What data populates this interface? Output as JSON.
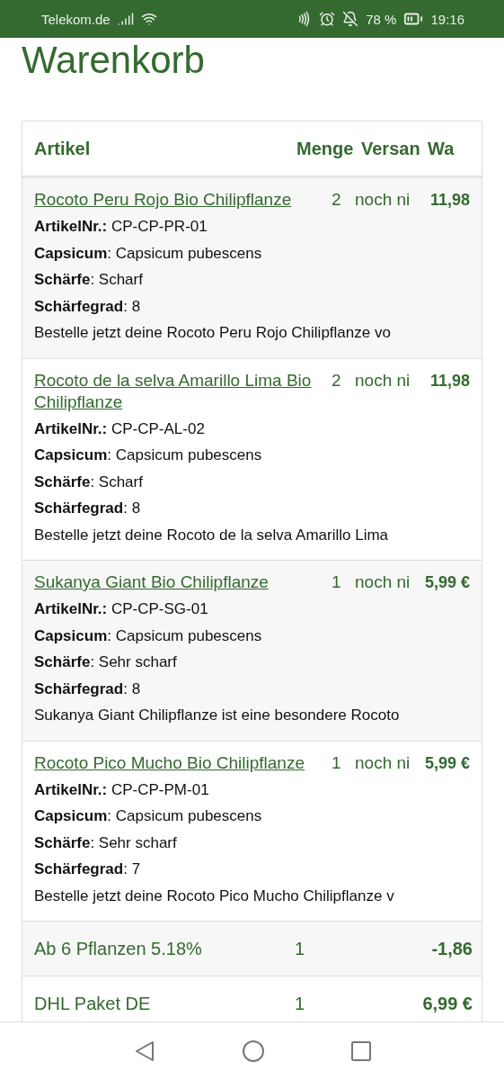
{
  "status_bar": {
    "carrier": "Telekom.de",
    "battery": "78 %",
    "time": "19:16"
  },
  "page": {
    "title": "Warenkorb"
  },
  "table": {
    "columns": [
      "Artikel",
      "Menge",
      "Versan",
      "Wa"
    ],
    "items": [
      {
        "name": "Rocoto Peru Rojo Bio Chilipflanze",
        "quantity": "2",
        "shipping": "noch ni",
        "price": "11,98",
        "details": [
          "**ArtikelNr.:** CP-CP-PR-01",
          "**Capsicum**: Capsicum pubescens",
          "**Schärfe**: Scharf",
          "**Schärfegrad**: 8",
          "Bestelle jetzt deine Rocoto Peru Rojo Chilipflanze vo"
        ]
      },
      {
        "name": "Rocoto de la selva Amarillo Lima Bio Chilipflanze",
        "quantity": "2",
        "shipping": "noch ni",
        "price": "11,98",
        "details": [
          "**ArtikelNr.:** CP-CP-AL-02",
          "**Capsicum**: Capsicum pubescens",
          "**Schärfe**: Scharf",
          "**Schärfegrad**: 8",
          "Bestelle jetzt deine Rocoto de la selva Amarillo Lima"
        ]
      },
      {
        "name": "Sukanya Giant Bio Chilipflanze",
        "quantity": "1",
        "shipping": "noch ni",
        "price": "5,99 €",
        "details": [
          "**ArtikelNr.:** CP-CP-SG-01",
          "**Capsicum**: Capsicum pubescens",
          "**Schärfe**: Sehr scharf",
          "**Schärfegrad**: 8",
          "Sukanya Giant Chilipflanze ist eine besondere Rocoto"
        ]
      },
      {
        "name": "Rocoto Pico Mucho Bio Chilipflanze",
        "quantity": "1",
        "shipping": "noch ni",
        "price": "5,99 €",
        "details": [
          "**ArtikelNr.:** CP-CP-PM-01",
          "**Capsicum**: Capsicum pubescens",
          "**Schärfe**: Sehr scharf",
          "**Schärfegrad**: 7",
          "Bestelle jetzt deine Rocoto Pico Mucho Chilipflanze v"
        ]
      }
    ],
    "summary": [
      {
        "label": "Ab 6 Pflanzen 5.18%",
        "quantity": "1",
        "amount": "-1,86"
      },
      {
        "label": "DHL Paket DE",
        "quantity": "1",
        "amount": "6,99 €"
      }
    ]
  }
}
